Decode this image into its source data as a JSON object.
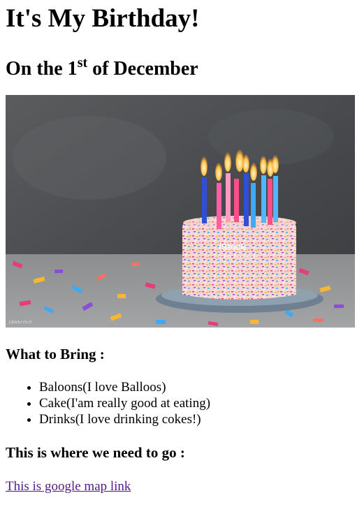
{
  "page": {
    "title": "It's My Birthday!",
    "date_prefix": "On the 1",
    "date_sup": "st",
    "date_suffix": " of December"
  },
  "hero_image": {
    "icon": "birthday-cake-photo",
    "watermark_brand": "iStock",
    "watermark_credit": "Credit: kirin_photo",
    "stock_id": "1302577572"
  },
  "bring": {
    "heading": "What to Bring :",
    "items": [
      "Baloons(I love Balloos)",
      "Cake(I'am really good at eating)",
      "Drinks(I love drinking cokes!)"
    ]
  },
  "location": {
    "heading": "This is where we need to go :",
    "link_text": "This is google map link"
  },
  "colors": {
    "link_visited": "#551a8b",
    "text": "#000000",
    "background": "#ffffff"
  }
}
